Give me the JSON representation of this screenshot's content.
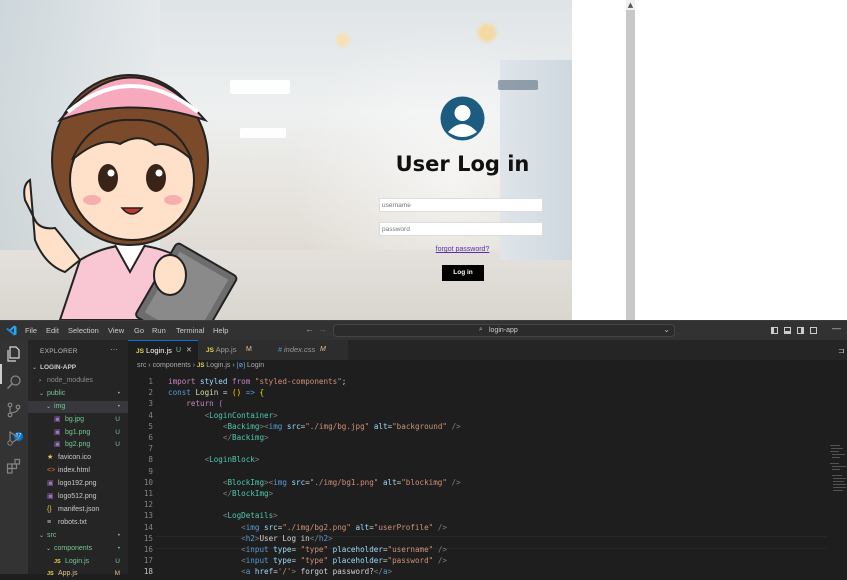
{
  "preview": {
    "login_title": "User Log in",
    "username_placeholder": "username",
    "password_placeholder": "password",
    "forgot_link": "forgot password?",
    "login_button": "Log in"
  },
  "vscode": {
    "menu": [
      "File",
      "Edit",
      "Selection",
      "View",
      "Go",
      "Run",
      "Terminal",
      "Help"
    ],
    "command_center": "login-app",
    "scm_badge": "17",
    "explorer_title": "EXPLORER",
    "explorer_more": "···",
    "tree": [
      {
        "name": "LOGIN-APP",
        "indent": 0,
        "twisty": "v",
        "icon": "",
        "status": "",
        "color": "#cccccc",
        "bold": true
      },
      {
        "name": "node_modules",
        "indent": 1,
        "twisty": ">",
        "icon": "",
        "status": "",
        "color": "#8b8b8b"
      },
      {
        "name": "public",
        "indent": 1,
        "twisty": "v",
        "icon": "",
        "status": "•",
        "color": "#73c991"
      },
      {
        "name": "img",
        "indent": 2,
        "twisty": "v",
        "icon": "",
        "status": "•",
        "color": "#73c991",
        "selected": true
      },
      {
        "name": "bg.jpg",
        "indent": 3,
        "twisty": "",
        "icon": "▣",
        "iconColor": "#a074c4",
        "status": "U",
        "color": "#73c991"
      },
      {
        "name": "bg1.png",
        "indent": 3,
        "twisty": "",
        "icon": "▣",
        "iconColor": "#a074c4",
        "status": "U",
        "color": "#73c991"
      },
      {
        "name": "bg2.png",
        "indent": 3,
        "twisty": "",
        "icon": "▣",
        "iconColor": "#a074c4",
        "status": "U",
        "color": "#73c991"
      },
      {
        "name": "favicon.ico",
        "indent": 2,
        "twisty": "",
        "icon": "★",
        "iconColor": "#e8c547",
        "status": "",
        "color": "#cccccc"
      },
      {
        "name": "index.html",
        "indent": 2,
        "twisty": "",
        "icon": "<>",
        "iconColor": "#e37933",
        "status": "",
        "color": "#cccccc"
      },
      {
        "name": "logo192.png",
        "indent": 2,
        "twisty": "",
        "icon": "▣",
        "iconColor": "#a074c4",
        "status": "",
        "color": "#cccccc"
      },
      {
        "name": "logo512.png",
        "indent": 2,
        "twisty": "",
        "icon": "▣",
        "iconColor": "#a074c4",
        "status": "",
        "color": "#cccccc"
      },
      {
        "name": "manifest.json",
        "indent": 2,
        "twisty": "",
        "icon": "{}",
        "iconColor": "#e8c547",
        "status": "",
        "color": "#cccccc"
      },
      {
        "name": "robots.txt",
        "indent": 2,
        "twisty": "",
        "icon": "≡",
        "iconColor": "#cccccc",
        "status": "",
        "color": "#cccccc"
      },
      {
        "name": "src",
        "indent": 1,
        "twisty": "v",
        "icon": "",
        "status": "•",
        "color": "#73c991"
      },
      {
        "name": "components",
        "indent": 2,
        "twisty": "v",
        "icon": "",
        "status": "•",
        "color": "#73c991"
      },
      {
        "name": "Login.js",
        "indent": 3,
        "twisty": "",
        "icon": "JS",
        "iconColor": "#e8d44d",
        "status": "U",
        "color": "#73c991"
      },
      {
        "name": "App.js",
        "indent": 2,
        "twisty": "",
        "icon": "JS",
        "iconColor": "#e8d44d",
        "status": "M",
        "color": "#e2c08d"
      }
    ],
    "tabs": [
      {
        "icon": "JS",
        "label": "Login.js",
        "mark": "U",
        "active": true,
        "close": "✕"
      },
      {
        "icon": "JS",
        "label": "App.js",
        "mark": "M",
        "active": false
      },
      {
        "icon": "#",
        "label": "index.css",
        "mark": "M",
        "active": false
      }
    ],
    "breadcrumb": {
      "p1": "src",
      "p2": "components",
      "file_icon": "JS",
      "file": "Login.js",
      "sym_icon": "[⊘]",
      "symbol": "Login",
      "sep": "›"
    },
    "code_lines": [
      {
        "n": "1",
        "h": "<span class=\"kw\">import</span> <span class=\"id\">styled</span> <span class=\"kw\">from</span> <span class=\"str\">\"styled-components\"</span>;"
      },
      {
        "n": "2",
        "h": "<span class=\"dc\">const</span> <span class=\"fn\">Login</span> = <span class=\"br\">()</span> <span class=\"dc\">=&gt;</span> <span class=\"br\">{</span>"
      },
      {
        "n": "3",
        "h": "    <span class=\"kw\">return</span> <span class=\"br2\">(</span>"
      },
      {
        "n": "4",
        "h": "        <span class=\"pn\">&lt;</span><span class=\"tg\">LoginContainer</span><span class=\"pn\">&gt;</span>"
      },
      {
        "n": "5",
        "h": "            <span class=\"pn\">&lt;</span><span class=\"tg\">Backimg</span><span class=\"pn\">&gt;&lt;</span><span class=\"ht\">img</span> <span class=\"at\">src</span>=<span class=\"str\">\"./img/bg.jpg\"</span> <span class=\"at\">alt</span>=<span class=\"str\">\"background\"</span> <span class=\"pn\">/&gt;</span>"
      },
      {
        "n": "6",
        "h": "            <span class=\"pn\">&lt;/</span><span class=\"tg\">Backimg</span><span class=\"pn\">&gt;</span>"
      },
      {
        "n": "7",
        "h": ""
      },
      {
        "n": "8",
        "h": "        <span class=\"pn\">&lt;</span><span class=\"tg\">LoginBlock</span><span class=\"pn\">&gt;</span>"
      },
      {
        "n": "9",
        "h": ""
      },
      {
        "n": "10",
        "h": "            <span class=\"pn\">&lt;</span><span class=\"tg\">BlockImg</span><span class=\"pn\">&gt;&lt;</span><span class=\"ht\">img</span> <span class=\"at\">src</span>=<span class=\"str\">\"./img/bg1.png\"</span> <span class=\"at\">alt</span>=<span class=\"str\">\"blockimg\"</span> <span class=\"pn\">/&gt;</span>"
      },
      {
        "n": "11",
        "h": "            <span class=\"pn\">&lt;/</span><span class=\"tg\">BlockImg</span><span class=\"pn\">&gt;</span>"
      },
      {
        "n": "12",
        "h": ""
      },
      {
        "n": "13",
        "h": "            <span class=\"pn\">&lt;</span><span class=\"tg\">LogDetails</span><span class=\"pn\">&gt;</span>"
      },
      {
        "n": "14",
        "h": "                <span class=\"pn\">&lt;</span><span class=\"ht\">img</span> <span class=\"at\">src</span>=<span class=\"str\">\"./img/bg2.png\"</span> <span class=\"at\">alt</span>=<span class=\"str\">\"userProfile\"</span> <span class=\"pn\">/&gt;</span>"
      },
      {
        "n": "15",
        "h": "                <span class=\"pn\">&lt;</span><span class=\"ht\">h2</span><span class=\"pn\">&gt;</span>User Log in<span class=\"pn\">&lt;/</span><span class=\"ht\">h2</span><span class=\"pn\">&gt;</span>"
      },
      {
        "n": "16",
        "h": "                <span class=\"pn\">&lt;</span><span class=\"ht\">input</span> <span class=\"at\">type</span>= <span class=\"str\">\"type\"</span> <span class=\"at\">placeholder</span>=<span class=\"str\">\"username\"</span> <span class=\"pn\">/&gt;</span>"
      },
      {
        "n": "17",
        "h": "                <span class=\"pn\">&lt;</span><span class=\"ht\">input</span> <span class=\"at\">type</span>= <span class=\"str\">\"type\"</span> <span class=\"at\">placeholder</span>=<span class=\"str\">\"password\"</span> <span class=\"pn\">/&gt;</span>"
      },
      {
        "n": "18",
        "h": "                <span class=\"pn\">&lt;</span><span class=\"ht\">a</span> <span class=\"at\">href</span>=<span class=\"str\">'/'</span><span class=\"pn\">&gt;</span> forgot password?<span class=\"pn\">&lt;/</span><span class=\"ht\">a</span><span class=\"pn\">&gt;</span>"
      }
    ],
    "current_line": "18",
    "colors": {
      "accent": "#0078d4",
      "untracked": "#73c991",
      "modified": "#e2c08d"
    }
  }
}
